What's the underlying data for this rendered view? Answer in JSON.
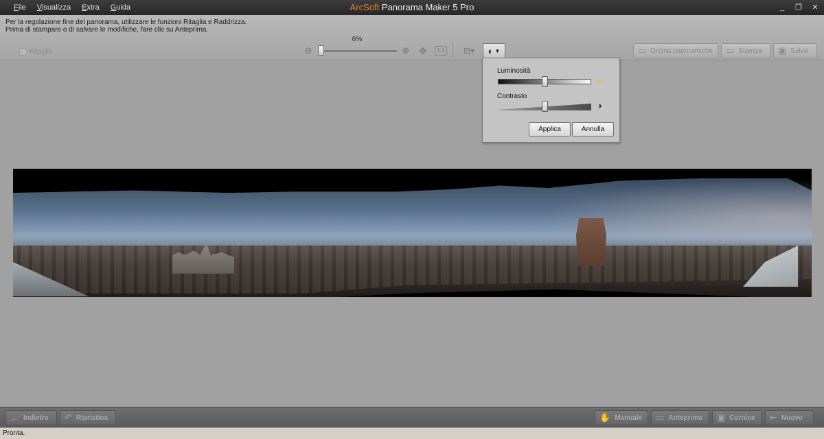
{
  "menu": {
    "items": [
      {
        "accel": "F",
        "rest": "ile"
      },
      {
        "accel": "V",
        "rest": "isualizza"
      },
      {
        "accel": "E",
        "rest": "xtra"
      },
      {
        "accel": "G",
        "rest": "uida"
      }
    ]
  },
  "window": {
    "brand": "ArcSoft",
    "title": " Panorama Maker 5 Pro",
    "minimize": "_",
    "restore": "❐",
    "close": "✕"
  },
  "instructions": {
    "line1": "Per la regolazione fine del panorama, utilizzare le funzioni Ritaglia e Raddrizza.",
    "line2": "Prima di stampare o di salvare le modifiche, fare clic su Anteprima."
  },
  "toolbar": {
    "crop_label": "Ritaglia",
    "crop_checked": false,
    "zoom_percent": "6%",
    "zoom_value": 0.06,
    "order_label": "Ordina panoramiche",
    "print_label": "Stampa",
    "save_label": "Salva"
  },
  "adjust_popup": {
    "brightness_label": "Luminosità",
    "brightness_value": 0.5,
    "contrast_label": "Contrasto",
    "contrast_value": 0.5,
    "apply_label": "Applica",
    "cancel_label": "Annulla"
  },
  "bottom_bar": {
    "back_label": "Indietro",
    "reset_label": "Ripristina",
    "manual_label": "Manuale",
    "preview_label": "Anteprima",
    "frame_label": "Cornice",
    "new_label": "Nuovo"
  },
  "status": {
    "text": "Pronta."
  },
  "colors": {
    "brand": "#e8822a",
    "canvas": "#a1a1a1"
  },
  "icons": {
    "zoom_out": "zoom-out-icon",
    "zoom_in": "zoom-in-icon",
    "fit": "fit-to-window-icon",
    "actual_size": "actual-size-icon",
    "straighten": "straighten-icon",
    "brightness_contrast": "brightness-contrast-icon",
    "sun": "sun-icon",
    "contrast": "contrast-icon"
  }
}
